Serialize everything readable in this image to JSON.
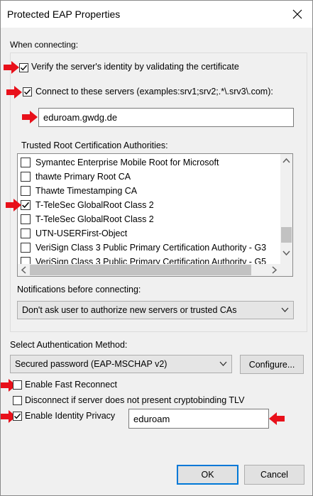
{
  "window": {
    "title": "Protected EAP Properties"
  },
  "connecting_group": {
    "label": "When connecting:"
  },
  "verify": {
    "label": "Verify the server's identity by validating the certificate",
    "checked": true
  },
  "connect_servers": {
    "label": "Connect to these servers (examples:srv1;srv2;.*\\.srv3\\.com):",
    "checked": true,
    "value": "eduroam.gwdg.de"
  },
  "trusted_root": {
    "label": "Trusted Root Certification Authorities:",
    "items": [
      {
        "label": "Symantec Enterprise Mobile Root for Microsoft",
        "checked": false
      },
      {
        "label": "thawte Primary Root CA",
        "checked": false
      },
      {
        "label": "Thawte Timestamping CA",
        "checked": false
      },
      {
        "label": "T-TeleSec GlobalRoot Class 2",
        "checked": true
      },
      {
        "label": "T-TeleSec GlobalRoot Class 2",
        "checked": false
      },
      {
        "label": "UTN-USERFirst-Object",
        "checked": false
      },
      {
        "label": "VeriSign Class 3 Public Primary Certification Authority - G3",
        "checked": false
      },
      {
        "label": "VeriSign Class 3 Public Primary Certification Authority - G5",
        "checked": false
      }
    ]
  },
  "notifications": {
    "label": "Notifications before connecting:",
    "selected": "Don't ask user to authorize new servers or trusted CAs"
  },
  "auth_method": {
    "label": "Select Authentication Method:",
    "selected": "Secured password (EAP-MSCHAP v2)",
    "configure_label": "Configure..."
  },
  "fast_reconnect": {
    "label": "Enable Fast Reconnect",
    "checked": false
  },
  "disconnect_tlv": {
    "label": "Disconnect if server does not present cryptobinding TLV",
    "checked": false
  },
  "identity_privacy": {
    "label": "Enable Identity Privacy",
    "checked": true,
    "value": "eduroam"
  },
  "buttons": {
    "ok": "OK",
    "cancel": "Cancel"
  },
  "colors": {
    "annotation_arrow": "#e8101a",
    "focus_blue": "#0078d7",
    "dialog_bg": "#f0f0f0"
  }
}
